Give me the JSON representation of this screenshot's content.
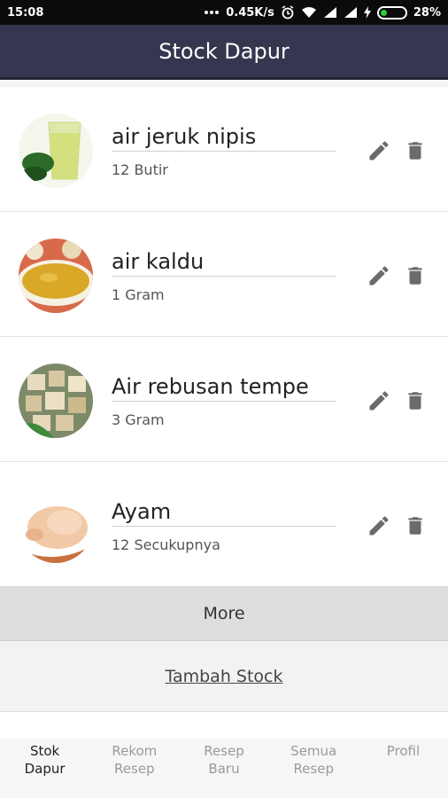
{
  "status_bar": {
    "time": "15:08",
    "net_speed": "0.45K/s",
    "battery": "28%",
    "battery_level": 0.28,
    "icons": [
      "dots-icon",
      "alarm-icon",
      "wifi-icon",
      "signal-icon",
      "signal-icon",
      "charging-icon",
      "battery-icon"
    ]
  },
  "app_bar": {
    "title": "Stock Dapur"
  },
  "items": [
    {
      "name": "air jeruk nipis",
      "qty": "12 Butir"
    },
    {
      "name": "air kaldu",
      "qty": "1 Gram"
    },
    {
      "name": "Air rebusan tempe",
      "qty": "3 Gram"
    },
    {
      "name": "Ayam",
      "qty": "12 Secukupnya"
    }
  ],
  "actions": {
    "edit_icon": "pencil-icon",
    "delete_icon": "trash-icon"
  },
  "more_label": "More",
  "add_stock_label": "Tambah Stock",
  "bottom_nav": [
    {
      "label": "Stok\nDapur",
      "active": true
    },
    {
      "label": "Rekom\nResep",
      "active": false
    },
    {
      "label": "Resep\nBaru",
      "active": false
    },
    {
      "label": "Semua\nResep",
      "active": false
    },
    {
      "label": "Profil",
      "active": false
    }
  ],
  "colors": {
    "app_bar": "#34374f",
    "status_bar": "#0b0b0d",
    "battery_fill": "#2ecc40",
    "icon_gray": "#6b6b6b"
  }
}
